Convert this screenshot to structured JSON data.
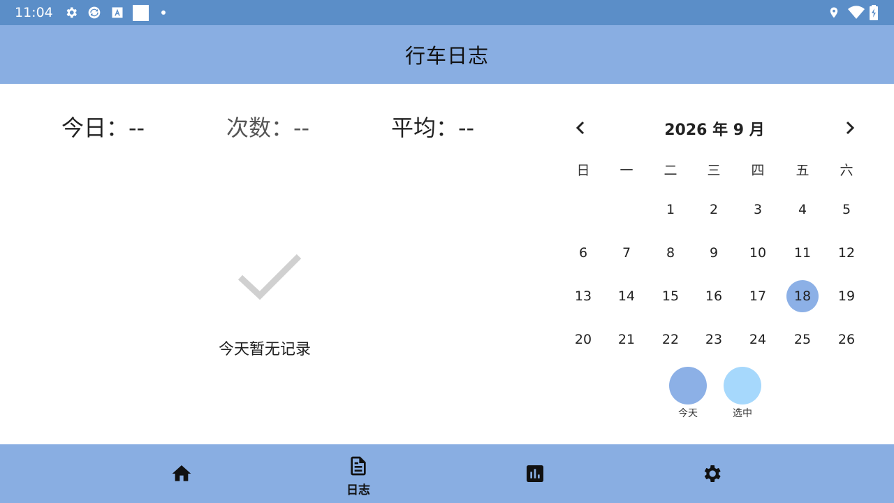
{
  "status_bar": {
    "time": "11:04",
    "left_icons": [
      "gear-icon",
      "sync-icon",
      "text-a-icon",
      "white-square",
      "dot"
    ],
    "right_icons": [
      "location-icon",
      "wifi-icon",
      "battery-charging-icon"
    ]
  },
  "app_bar": {
    "title": "行车日志"
  },
  "stats": {
    "today": "今日：--",
    "count": "次数：--",
    "average": "平均：--"
  },
  "empty_state": {
    "icon": "check-icon",
    "text": "今天暂无记录"
  },
  "calendar": {
    "title": "2026 年 9 月",
    "prev_icon": "chevron-left-icon",
    "next_icon": "chevron-right-icon",
    "weekdays": [
      "日",
      "一",
      "二",
      "三",
      "四",
      "五",
      "六"
    ],
    "weeks": [
      [
        "",
        "",
        "1",
        "2",
        "3",
        "4",
        "5"
      ],
      [
        "6",
        "7",
        "8",
        "9",
        "10",
        "11",
        "12"
      ],
      [
        "13",
        "14",
        "15",
        "16",
        "17",
        "18",
        "19"
      ],
      [
        "20",
        "21",
        "22",
        "23",
        "24",
        "25",
        "26"
      ]
    ],
    "today_day": "18",
    "legend": [
      {
        "label": "今天",
        "color": "#8cb0e6"
      },
      {
        "label": "选中",
        "color": "#a6d8fc"
      }
    ]
  },
  "bottom_nav": {
    "items": [
      {
        "icon": "home-icon",
        "label": ""
      },
      {
        "icon": "document-icon",
        "label": "日志"
      },
      {
        "icon": "chart-icon",
        "label": ""
      },
      {
        "icon": "gear-icon",
        "label": ""
      }
    ]
  },
  "colors": {
    "status_bar": "#5b8ec8",
    "app_bar": "#89aee2",
    "today_highlight": "#8cb0e6",
    "selected_highlight": "#a6d8fc"
  }
}
